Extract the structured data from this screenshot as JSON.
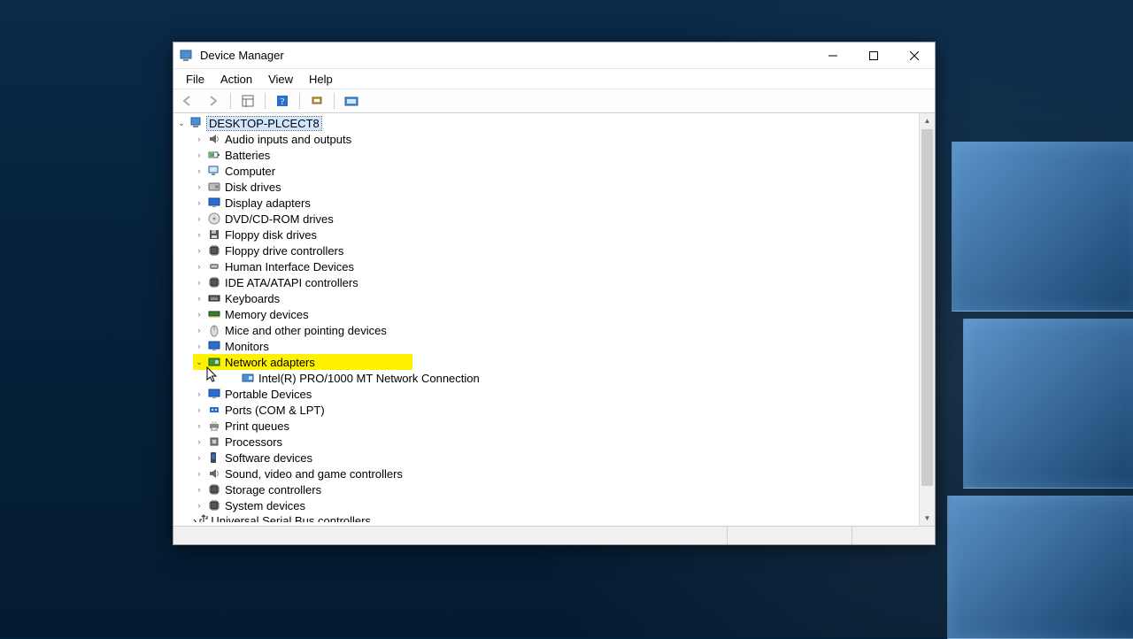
{
  "window": {
    "title": "Device Manager"
  },
  "menu": {
    "file": "File",
    "action": "Action",
    "view": "View",
    "help": "Help"
  },
  "root": {
    "name": "DESKTOP-PLCECT8"
  },
  "categories": [
    {
      "key": "audio",
      "label": "Audio inputs and outputs"
    },
    {
      "key": "batteries",
      "label": "Batteries"
    },
    {
      "key": "computer",
      "label": "Computer"
    },
    {
      "key": "disk",
      "label": "Disk drives"
    },
    {
      "key": "display",
      "label": "Display adapters"
    },
    {
      "key": "dvd",
      "label": "DVD/CD-ROM drives"
    },
    {
      "key": "floppy_disk",
      "label": "Floppy disk drives"
    },
    {
      "key": "floppy_ctrl",
      "label": "Floppy drive controllers"
    },
    {
      "key": "hid",
      "label": "Human Interface Devices"
    },
    {
      "key": "ide",
      "label": "IDE ATA/ATAPI controllers"
    },
    {
      "key": "keyboards",
      "label": "Keyboards"
    },
    {
      "key": "memory",
      "label": "Memory devices"
    },
    {
      "key": "mice",
      "label": "Mice and other pointing devices"
    },
    {
      "key": "monitors",
      "label": "Monitors"
    },
    {
      "key": "network",
      "label": "Network adapters",
      "expanded": true,
      "highlighted": true,
      "children": [
        {
          "key": "intel_nic",
          "label": "Intel(R) PRO/1000 MT Network Connection"
        }
      ]
    },
    {
      "key": "portable",
      "label": "Portable Devices"
    },
    {
      "key": "ports",
      "label": "Ports (COM & LPT)"
    },
    {
      "key": "printq",
      "label": "Print queues"
    },
    {
      "key": "processors",
      "label": "Processors"
    },
    {
      "key": "software",
      "label": "Software devices"
    },
    {
      "key": "sound",
      "label": "Sound, video and game controllers"
    },
    {
      "key": "storage",
      "label": "Storage controllers"
    },
    {
      "key": "system",
      "label": "System devices"
    },
    {
      "key": "usb",
      "label": "Universal Serial Bus controllers",
      "clipped": true
    }
  ],
  "icons": {
    "audio": "speaker",
    "batteries": "battery",
    "computer": "pc",
    "disk": "hdd",
    "display": "monitor",
    "dvd": "disc",
    "floppy_disk": "floppy",
    "floppy_ctrl": "chip",
    "hid": "hid",
    "ide": "chip",
    "keyboards": "keyboard",
    "memory": "ram",
    "mice": "mouse",
    "monitors": "monitor",
    "network": "nic",
    "portable": "monitor",
    "ports": "port",
    "printq": "printer",
    "processors": "cpu",
    "software": "sw",
    "sound": "speaker",
    "storage": "chip",
    "system": "chip",
    "usb": "usb",
    "intel_nic": "nic-child"
  }
}
